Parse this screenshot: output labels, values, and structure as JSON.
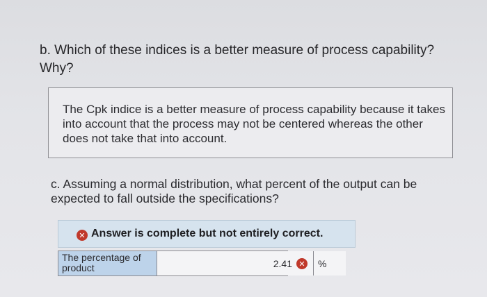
{
  "question_b": {
    "text": "b. Which of these indices is a better measure of process capability? Why?"
  },
  "answer_b": {
    "text": "The Cpk indice is a better measure of process capability because it takes into account that the process may not be centered whereas the other does not take that into account."
  },
  "question_c": {
    "text": "c. Assuming a normal distribution, what percent of the output can be expected to fall outside the specifications?"
  },
  "feedback": {
    "text": "Answer is complete but not entirely correct.",
    "icon": "incorrect-x-icon",
    "icon_glyph": "✕",
    "color": "#c0392b"
  },
  "answer_table": {
    "row_label": "The percentage of product",
    "value": "2.41",
    "unit": "%",
    "icon_glyph": "✕"
  }
}
